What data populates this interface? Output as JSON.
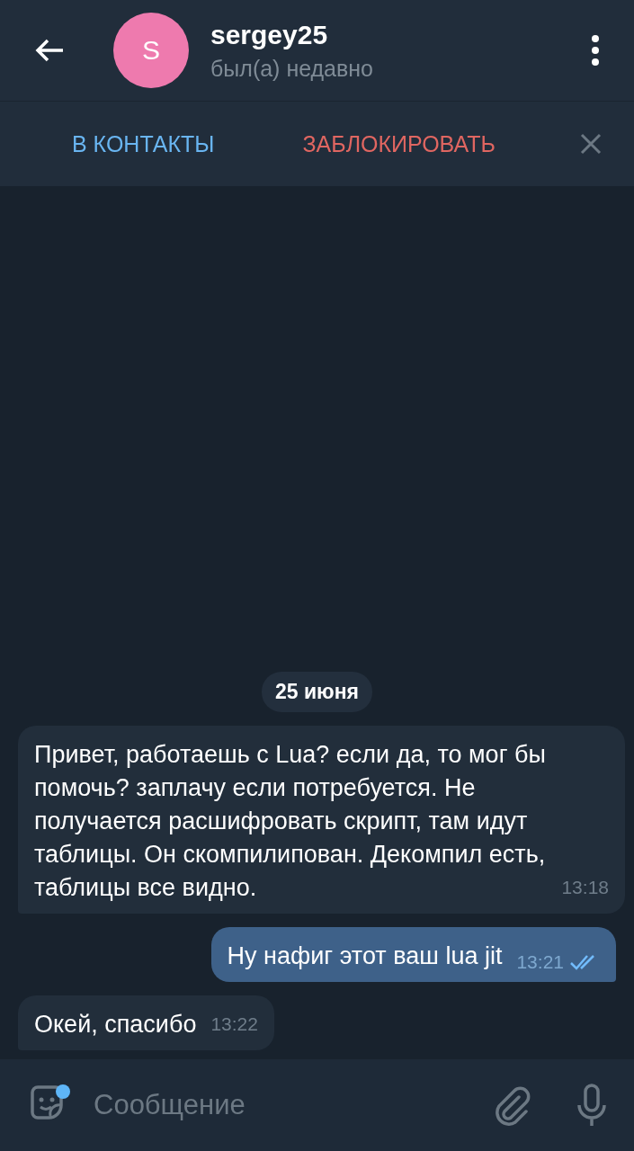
{
  "header": {
    "avatar_letter": "S",
    "name": "sergey25",
    "status": "был(а) недавно"
  },
  "action_bar": {
    "add_contact": "В КОНТАКТЫ",
    "block": "ЗАБЛОКИРОВАТЬ"
  },
  "date": "25 июня",
  "messages": [
    {
      "kind": "incoming",
      "text": "Привет, работаешь с Lua? если да, то мог бы помочь? заплачу если потребуется. Не получается расшифровать скрипт, там идут таблицы. Он скомпилипован. Декомпил есть, таблицы все видно.",
      "time": "13:18"
    },
    {
      "kind": "outgoing",
      "text": "Ну нафиг этот ваш lua jit",
      "time": "13:21",
      "read": true
    },
    {
      "kind": "incoming",
      "text": "Окей, спасибо",
      "time": "13:22"
    }
  ],
  "composer": {
    "placeholder": "Сообщение"
  }
}
